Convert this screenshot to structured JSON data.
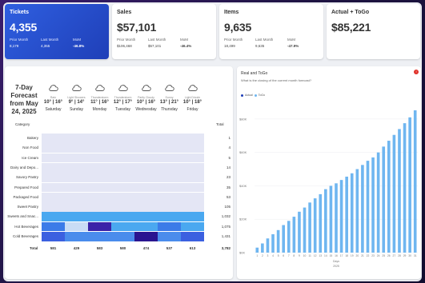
{
  "kpis": [
    {
      "title": "Tickets",
      "value": "4,355",
      "labels": [
        "Prior Month",
        "Last Month",
        "MoM"
      ],
      "values": [
        "8,179",
        "4,355",
        "-46.8%"
      ]
    },
    {
      "title": "Sales",
      "value": "$57,101",
      "labels": [
        "Prior Month",
        "Last Month",
        "MoM"
      ],
      "values": [
        "$106,468",
        "$57,101",
        "-46.4%"
      ]
    },
    {
      "title": "Items",
      "value": "9,635",
      "labels": [
        "Prior Month",
        "Last Month",
        "MoM"
      ],
      "values": [
        "18,499",
        "9,635",
        "-47.9%"
      ]
    },
    {
      "title": "Actual + ToGo",
      "value": "$85,221"
    }
  ],
  "forecast": {
    "title": "7-Day Forecast from May 24, 2025",
    "category_label": "Category",
    "total_label": "Total",
    "columns": [
      {
        "condition": "Rain",
        "temp": "10° | 16°",
        "day": "Saturday"
      },
      {
        "condition": "Light Showers",
        "temp": "9° | 14°",
        "day": "Sunday"
      },
      {
        "condition": "Thunderstorm",
        "temp": "11° | 16°",
        "day": "Monday"
      },
      {
        "condition": "Thunderstorm",
        "temp": "12° | 17°",
        "day": "Tuesday"
      },
      {
        "condition": "Partly Cloudy",
        "temp": "10° | 16°",
        "day": "Wednesday"
      },
      {
        "condition": "Sunny",
        "temp": "13° | 21°",
        "day": "Thursday"
      },
      {
        "condition": "Light Drizzle",
        "temp": "10° | 18°",
        "day": "Friday"
      }
    ],
    "rows": [
      {
        "label": "Bakery",
        "total": "1"
      },
      {
        "label": "Non Food",
        "total": "4"
      },
      {
        "label": "Ice Cream",
        "total": "5"
      },
      {
        "label": "Dairy and Depo...",
        "total": "14"
      },
      {
        "label": "Savory Pastry",
        "total": "23"
      },
      {
        "label": "Prepared Food",
        "total": "35"
      },
      {
        "label": "Packaged Food",
        "total": "53"
      },
      {
        "label": "Sweet Pastry",
        "total": "105"
      },
      {
        "label": "Sweets and Snac...",
        "total": "1,032"
      },
      {
        "label": "Hot Beverages",
        "total": "1,075"
      },
      {
        "label": "Cold Beverages",
        "total": "1,431"
      }
    ],
    "grand_total_label": "Total",
    "column_totals": [
      "581",
      "429",
      "583",
      "580",
      "474",
      "537",
      "613"
    ],
    "grand_total": "3,782",
    "heat_colors": [
      [
        "#e4e6f5",
        "#e4e6f5",
        "#e4e6f5",
        "#e4e6f5",
        "#e4e6f5",
        "#e4e6f5",
        "#e4e6f5"
      ],
      [
        "#e4e6f5",
        "#e4e6f5",
        "#e4e6f5",
        "#e4e6f5",
        "#e4e6f5",
        "#e4e6f5",
        "#e4e6f5"
      ],
      [
        "#e4e6f5",
        "#e4e6f5",
        "#e4e6f5",
        "#e4e6f5",
        "#e4e6f5",
        "#e4e6f5",
        "#e4e6f5"
      ],
      [
        "#e4e6f5",
        "#e4e6f5",
        "#e4e6f5",
        "#e4e6f5",
        "#e4e6f5",
        "#e4e6f5",
        "#e4e6f5"
      ],
      [
        "#e4e6f5",
        "#e4e6f5",
        "#e4e6f5",
        "#e4e6f5",
        "#e4e6f5",
        "#e4e6f5",
        "#e4e6f5"
      ],
      [
        "#e4e6f5",
        "#e4e6f5",
        "#e4e6f5",
        "#e4e6f5",
        "#e4e6f5",
        "#e4e6f5",
        "#e4e6f5"
      ],
      [
        "#e4e6f5",
        "#e4e6f5",
        "#e4e6f5",
        "#e4e6f5",
        "#e4e6f5",
        "#e4e6f5",
        "#e4e6f5"
      ],
      [
        "#e4e6f5",
        "#e4e6f5",
        "#e4e6f5",
        "#e4e6f5",
        "#e4e6f5",
        "#e4e6f5",
        "#e4e6f5"
      ],
      [
        "#4aa8f0",
        "#4aa8f0",
        "#4aa8f0",
        "#4aa8f0",
        "#4aa8f0",
        "#4aa8f0",
        "#4aa8f0"
      ],
      [
        "#3b7be8",
        "#c9dcf5",
        "#3a22a8",
        "#4aa8f0",
        "#4aa8f0",
        "#3b7be8",
        "#4aa8f0"
      ],
      [
        "#3b60e0",
        "#4a8cec",
        "#4a8cec",
        "#4a8cec",
        "#2a1590",
        "#4a8cec",
        "#3b60e0"
      ]
    ]
  },
  "chart_panel": {
    "title": "Real and ToGo",
    "subtitle": "What is the closing of the current month forecast?",
    "badge": "!"
  },
  "chart_data": {
    "type": "bar",
    "title": "Real and ToGo",
    "xlabel": "Days",
    "x_sub": "2025",
    "legend": [
      {
        "name": "Actual",
        "color": "#1f3fb8"
      },
      {
        "name": "ToGo",
        "color": "#6fb6f0"
      }
    ],
    "ylim": [
      0,
      90000
    ],
    "y_ticks": [
      "$0K",
      "$20K",
      "$40K",
      "$60K",
      "$80K"
    ],
    "categories": [
      "1",
      "2",
      "3",
      "4",
      "5",
      "6",
      "7",
      "8",
      "9",
      "10",
      "11",
      "12",
      "13",
      "14",
      "15",
      "16",
      "17",
      "18",
      "19",
      "20",
      "21",
      "22",
      "23",
      "24",
      "25",
      "26",
      "27",
      "28",
      "29",
      "30",
      "31"
    ],
    "series": [
      {
        "name": "Actual",
        "values": [
          3000,
          5500,
          8500,
          11000,
          13500,
          16500,
          19000,
          21500,
          24500,
          27000,
          30000,
          32500,
          35000,
          38000,
          40000,
          41500,
          43500,
          45500,
          47500,
          50000,
          52500,
          55000,
          57000,
          0,
          0,
          0,
          0,
          0,
          0,
          0,
          0
        ]
      },
      {
        "name": "ToGo",
        "values": [
          0,
          0,
          0,
          0,
          0,
          0,
          0,
          0,
          0,
          0,
          0,
          0,
          0,
          0,
          0,
          0,
          0,
          0,
          0,
          0,
          0,
          0,
          0,
          60000,
          63500,
          67000,
          70500,
          74000,
          77500,
          81000,
          85221
        ]
      }
    ]
  }
}
